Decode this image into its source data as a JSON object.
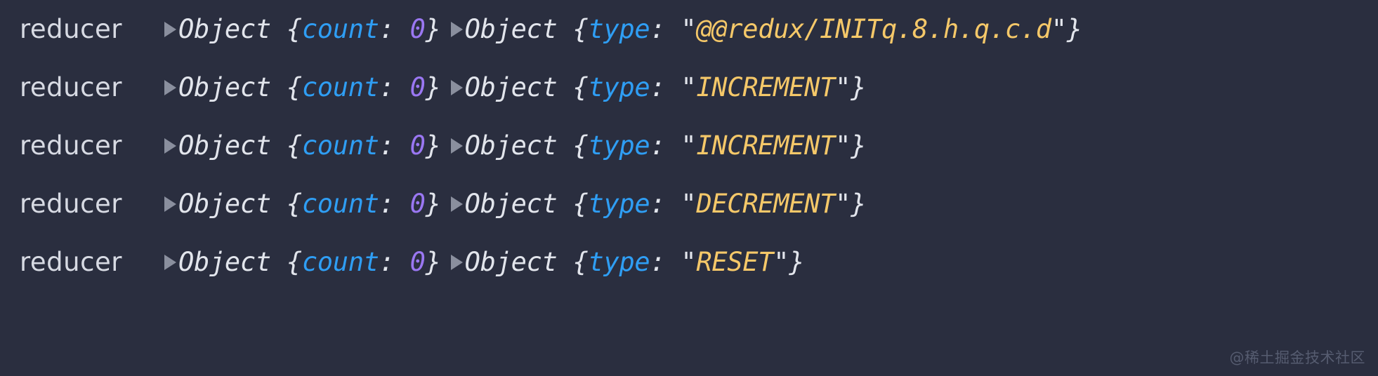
{
  "panel": {
    "background_color": "#2a2e3f",
    "source_label_color": "#d7dae3",
    "key_color": "#2f9ef4",
    "number_color": "#9a77f2",
    "string_color": "#f5c869",
    "punctuation_color": "#e2e5ec",
    "triangle_color": "#8a8f9e"
  },
  "tokens": {
    "object_label": "Object",
    "brace_open": "{",
    "brace_close": "}",
    "colon_space": ": ",
    "quote": "\""
  },
  "logs": [
    {
      "source": "reducer",
      "state": {
        "expander": "collapsed-triangle",
        "type_name": "Object",
        "key": "count",
        "value": "0"
      },
      "action": {
        "expander": "collapsed-triangle",
        "type_name": "Object",
        "key": "type",
        "value": "@@redux/INITq.8.h.q.c.d"
      }
    },
    {
      "source": "reducer",
      "state": {
        "expander": "collapsed-triangle",
        "type_name": "Object",
        "key": "count",
        "value": "0"
      },
      "action": {
        "expander": "collapsed-triangle",
        "type_name": "Object",
        "key": "type",
        "value": "INCREMENT"
      }
    },
    {
      "source": "reducer",
      "state": {
        "expander": "collapsed-triangle",
        "type_name": "Object",
        "key": "count",
        "value": "0"
      },
      "action": {
        "expander": "collapsed-triangle",
        "type_name": "Object",
        "key": "type",
        "value": "INCREMENT"
      }
    },
    {
      "source": "reducer",
      "state": {
        "expander": "collapsed-triangle",
        "type_name": "Object",
        "key": "count",
        "value": "0"
      },
      "action": {
        "expander": "collapsed-triangle",
        "type_name": "Object",
        "key": "type",
        "value": "DECREMENT"
      }
    },
    {
      "source": "reducer",
      "state": {
        "expander": "collapsed-triangle",
        "type_name": "Object",
        "key": "count",
        "value": "0"
      },
      "action": {
        "expander": "collapsed-triangle",
        "type_name": "Object",
        "key": "type",
        "value": "RESET"
      }
    }
  ],
  "watermark": {
    "text": "@稀土掘金技术社区"
  }
}
